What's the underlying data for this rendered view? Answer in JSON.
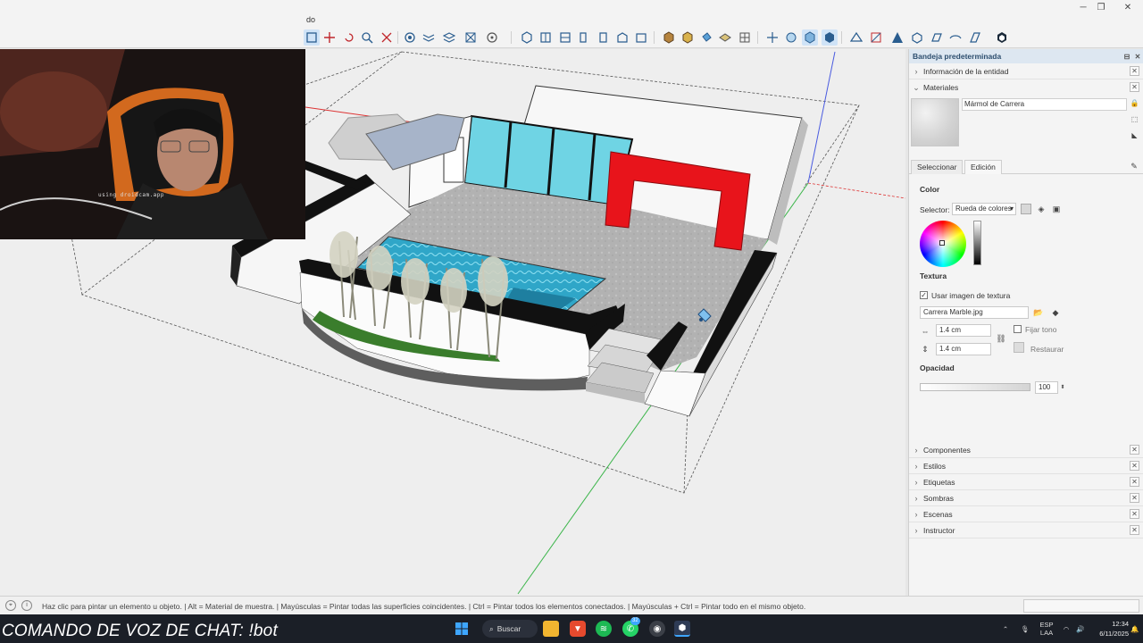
{
  "window": {
    "title_fragment": "do"
  },
  "webcam": {
    "watermark": "using droidcam.app"
  },
  "tray": {
    "title": "Bandeja predeterminada",
    "sections_top": [
      {
        "label": "Información de la entidad"
      },
      {
        "label": "Materiales"
      }
    ],
    "material_name": "Mármol de Carrera",
    "tabs": [
      "Seleccionar",
      "Edición"
    ],
    "active_tab": "Edición",
    "edit": {
      "color_heading": "Color",
      "selector_label": "Selector:",
      "selector_value": "Rueda de colores",
      "texture_heading": "Textura",
      "use_texture_label": "Usar imagen de textura",
      "use_texture_checked": "✓",
      "texture_file": "Carrera Marble.jpg",
      "width_value": "1.4 cm",
      "height_value": "1.4 cm",
      "fix_tone_label": "Fijar tono",
      "restore_label": "Restaurar",
      "opacity_heading": "Opacidad",
      "opacity_value": "100"
    },
    "sections_bottom": [
      {
        "label": "Componentes"
      },
      {
        "label": "Estilos"
      },
      {
        "label": "Etiquetas"
      },
      {
        "label": "Sombras"
      },
      {
        "label": "Escenas"
      },
      {
        "label": "Instructor"
      }
    ]
  },
  "status": {
    "hint": "Haz clic para pintar un elemento u objeto. | Alt = Material de muestra. | Mayúsculas = Pintar todas las superficies coincidentes. | Ctrl = Pintar todos los elementos conectados. | Mayúsculas + Ctrl = Pintar todo en el mismo objeto."
  },
  "taskbar": {
    "voice_command": "COMANDO DE VOZ DE CHAT: !bot",
    "search_label": "Buscar",
    "whatsapp_badge": "32",
    "language": "ESP",
    "region": "LAA",
    "time": "12:34",
    "date": "6/11/2025"
  },
  "colors": {
    "accent_red": "#e8141b",
    "pool_blue": "#2fa6c8",
    "glass": "#6fd4e4",
    "tray_header": "#dde7f1"
  }
}
